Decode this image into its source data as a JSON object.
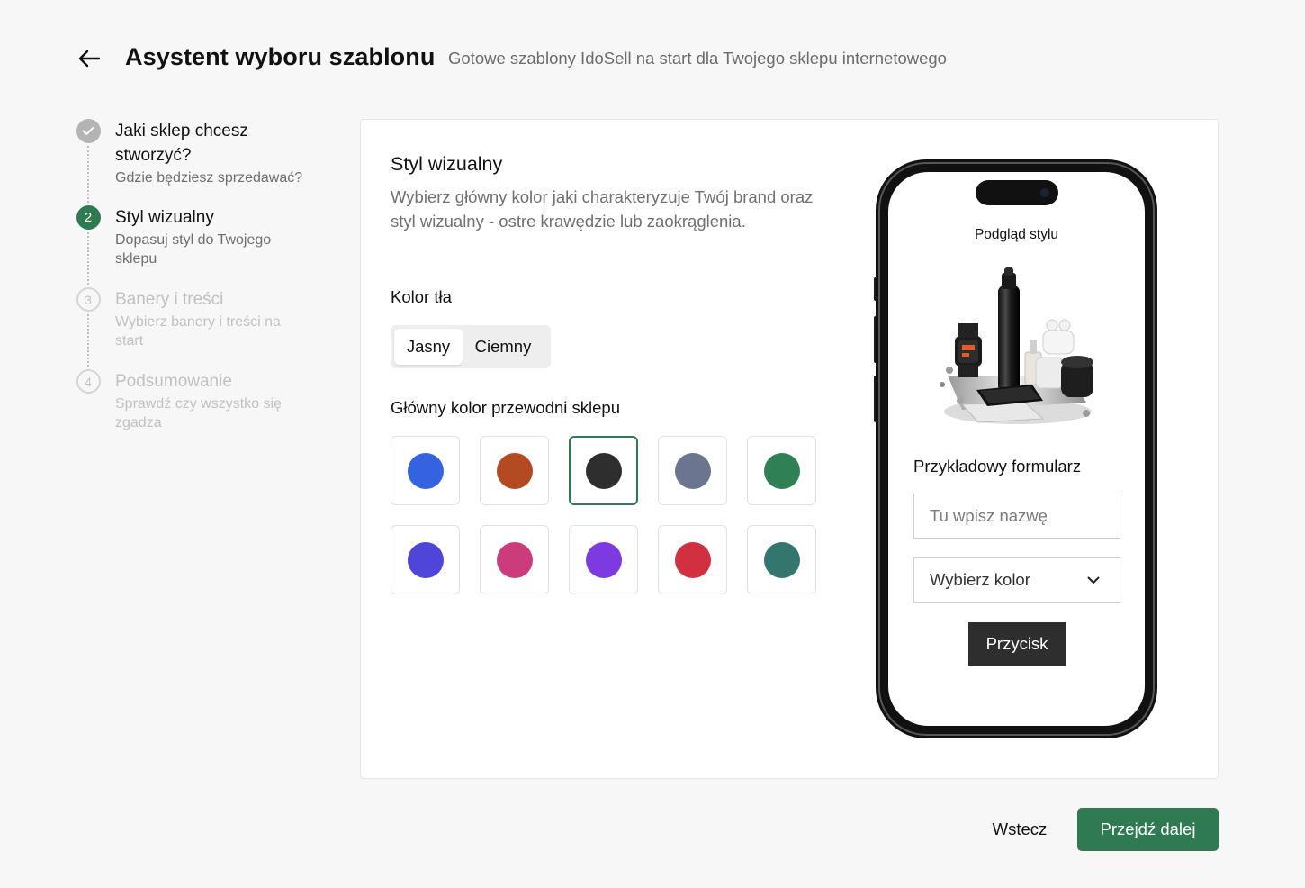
{
  "header": {
    "back_icon": "arrow-left-icon",
    "title": "Asystent wyboru szablonu",
    "subtitle": "Gotowe szablony IdoSell na start dla Twojego sklepu internetowego"
  },
  "steps": [
    {
      "number": "1",
      "state": "done",
      "icon": "check-icon",
      "title": "Jaki sklep chcesz stworzyć?",
      "description": "Gdzie będziesz sprzedawać?"
    },
    {
      "number": "2",
      "state": "active",
      "title": "Styl wizualny",
      "description": "Dopasuj styl do Twojego sklepu"
    },
    {
      "number": "3",
      "state": "todo",
      "title": "Banery i treści",
      "description": "Wybierz banery i treści na start"
    },
    {
      "number": "4",
      "state": "todo",
      "title": "Podsumowanie",
      "description": "Sprawdź czy wszystko się zgadza"
    }
  ],
  "style_section": {
    "title": "Styl wizualny",
    "description": "Wybierz główny kolor jaki charakteryzuje Twój brand oraz styl wizualny - ostre krawędzie lub zaokrąglenia.",
    "background_label": "Kolor tła",
    "background_options": [
      "Jasny",
      "Ciemny"
    ],
    "background_selected": "Jasny",
    "main_color_label": "Główny kolor przewodni sklepu",
    "colors": [
      "#3563e0",
      "#b44a21",
      "#2e2e2e",
      "#6b7590",
      "#2f8054",
      "#4f45d9",
      "#cc3c7c",
      "#7c3ae0",
      "#d0303f",
      "#32766d"
    ],
    "selected_color_index": 2
  },
  "preview": {
    "label": "Podgląd stylu",
    "form_title": "Przykładowy formularz",
    "name_placeholder": "Tu wpisz nazwę",
    "select_label": "Wybierz kolor",
    "button_label": "Przycisk"
  },
  "footer": {
    "back_label": "Wstecz",
    "next_label": "Przejdź dalej",
    "accent_color": "#2f7a53"
  }
}
